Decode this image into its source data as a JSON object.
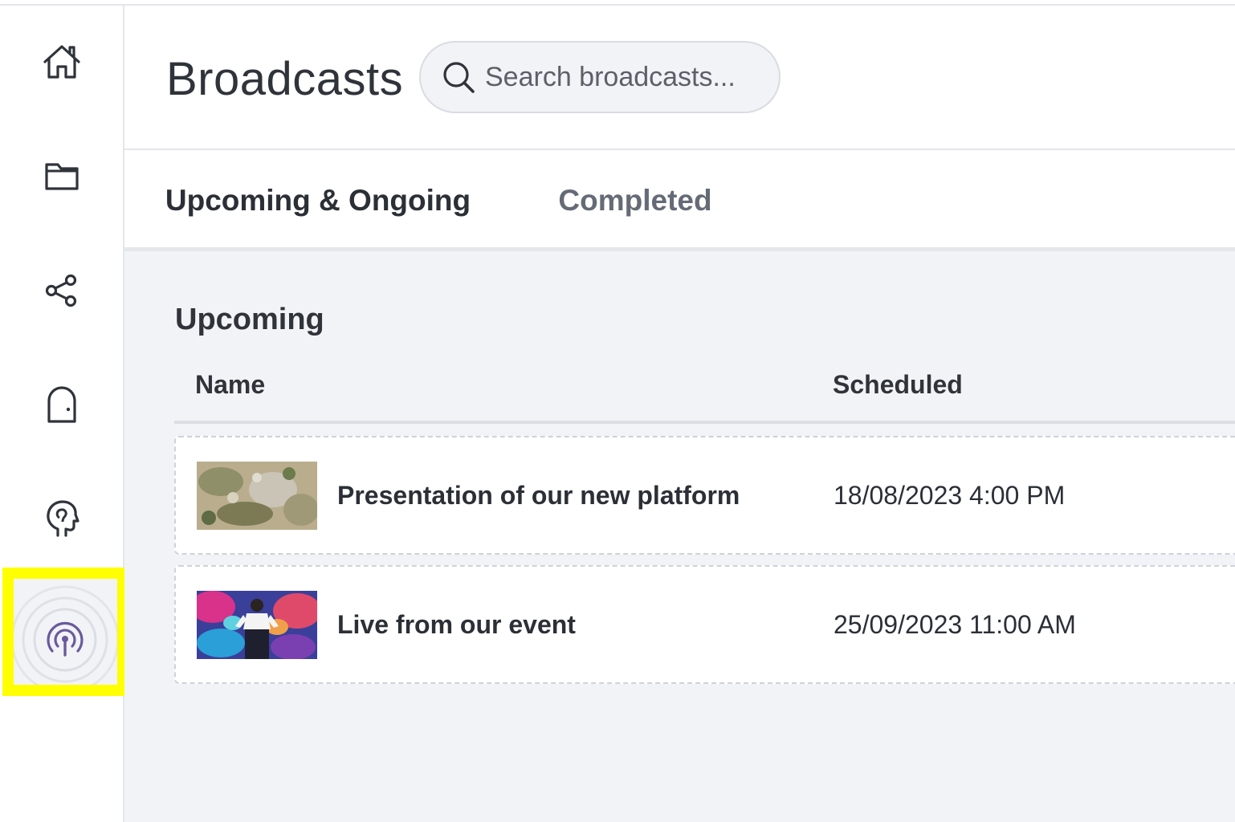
{
  "sidebar": {
    "items": [
      {
        "icon": "home-icon"
      },
      {
        "icon": "folder-icon"
      },
      {
        "icon": "share-icon"
      },
      {
        "icon": "door-icon"
      },
      {
        "icon": "head-icon"
      },
      {
        "icon": "broadcast-icon",
        "active": true
      }
    ],
    "active_color": "#6a5a9c",
    "highlight_color": "#ffff00"
  },
  "header": {
    "title": "Broadcasts",
    "search_placeholder": "Search broadcasts..."
  },
  "tabs": [
    {
      "label": "Upcoming & Ongoing",
      "active": true
    },
    {
      "label": "Completed",
      "active": false
    }
  ],
  "section": {
    "title": "Upcoming",
    "columns": {
      "name": "Name",
      "scheduled": "Scheduled"
    },
    "rows": [
      {
        "name": "Presentation of our new platform",
        "scheduled": "18/08/2023 4:00 PM"
      },
      {
        "name": "Live from our event",
        "scheduled": "25/09/2023 11:00 AM"
      }
    ]
  }
}
